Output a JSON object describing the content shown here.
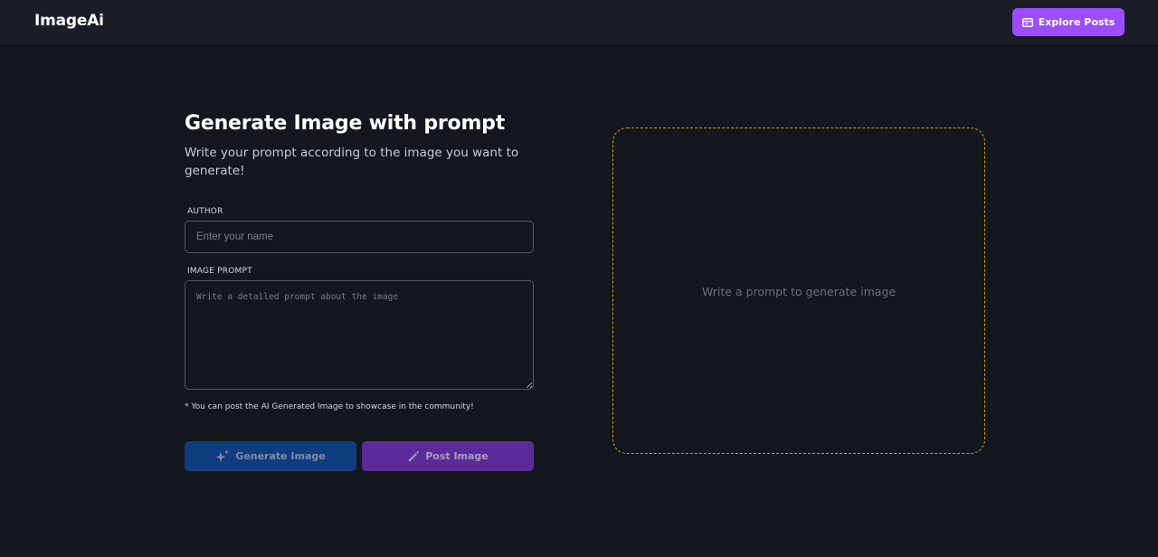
{
  "app": {
    "logo": "ImageAi"
  },
  "header": {
    "explore_label": "Explore Posts",
    "explore_icon": "posts-icon",
    "accent_color": "#9b4dff"
  },
  "form": {
    "title": "Generate Image with prompt",
    "subtitle": "Write your prompt according to the image you want to generate!",
    "author": {
      "label": "AUTHOR",
      "placeholder": "Enter your name",
      "value": ""
    },
    "prompt": {
      "label": "IMAGE PROMPT",
      "placeholder": "Write a detailed prompt about the image",
      "value": ""
    },
    "note": "* You can post the AI Generated Image to showcase in the community!",
    "generate_button": {
      "label": "Generate Image",
      "icon": "sparkle-icon",
      "color": "#0f3e80"
    },
    "post_button": {
      "label": "Post Image",
      "icon": "pencil-icon",
      "color": "#5b2c99"
    }
  },
  "preview": {
    "placeholder": "Write a prompt to generate image",
    "border_color": "#c99d1e"
  }
}
